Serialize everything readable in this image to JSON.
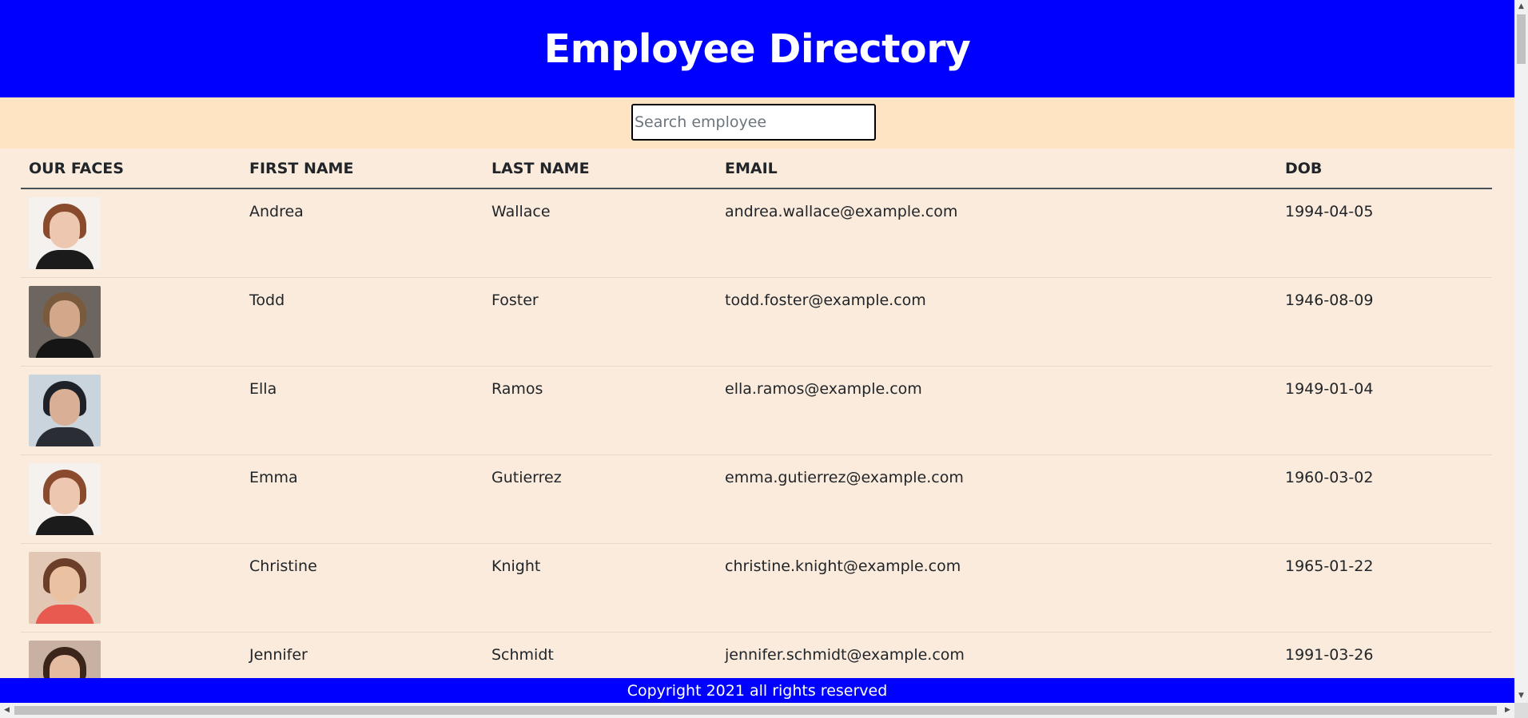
{
  "header": {
    "title": "Employee Directory"
  },
  "search": {
    "placeholder": "Search employee",
    "value": ""
  },
  "table": {
    "columns": [
      "OUR FACES",
      "FIRST NAME",
      "LAST NAME",
      "EMAIL",
      "DOB"
    ],
    "rows": [
      {
        "first": "Andrea",
        "last": "Wallace",
        "email": "andrea.wallace@example.com",
        "dob": "1994-04-05"
      },
      {
        "first": "Todd",
        "last": "Foster",
        "email": "todd.foster@example.com",
        "dob": "1946-08-09"
      },
      {
        "first": "Ella",
        "last": "Ramos",
        "email": "ella.ramos@example.com",
        "dob": "1949-01-04"
      },
      {
        "first": "Emma",
        "last": "Gutierrez",
        "email": "emma.gutierrez@example.com",
        "dob": "1960-03-02"
      },
      {
        "first": "Christine",
        "last": "Knight",
        "email": "christine.knight@example.com",
        "dob": "1965-01-22"
      },
      {
        "first": "Jennifer",
        "last": "Schmidt",
        "email": "jennifer.schmidt@example.com",
        "dob": "1991-03-26"
      }
    ]
  },
  "footer": {
    "text": "Copyright 2021 all rights reserved"
  },
  "colors": {
    "header_bg": "#0000ff",
    "search_bg": "#ffe4c4",
    "page_bg": "#faebdc",
    "footer_bg": "#0000ff"
  }
}
